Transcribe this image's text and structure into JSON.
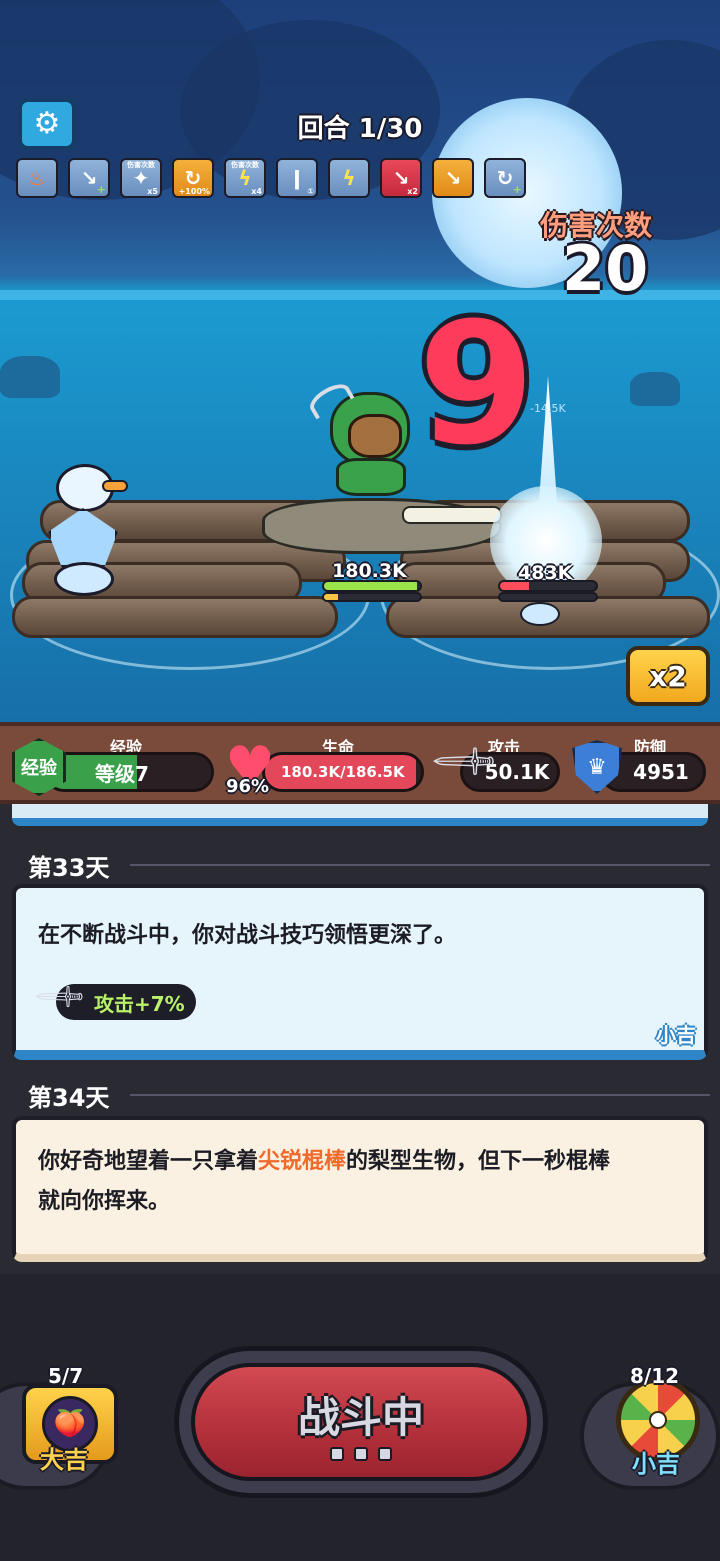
{
  "hud": {
    "round_label": "回合 1/30",
    "settings_icon": "gear-icon",
    "skill_icons": [
      {
        "icon": "flame-icon",
        "style": "orange-flame",
        "top_tag": "",
        "tag": ""
      },
      {
        "icon": "dagger-plus-icon",
        "style": "blue",
        "top_tag": "",
        "tag": ""
      },
      {
        "icon": "ice-shard-icon",
        "style": "blue",
        "top_tag": "伤害次数",
        "tag": "x5"
      },
      {
        "icon": "whirl-icon",
        "style": "orange",
        "top_tag": "",
        "tag": "+100%"
      },
      {
        "icon": "lightning-icon",
        "style": "blue",
        "top_tag": "伤害次数",
        "tag": "x4"
      },
      {
        "icon": "spear-icon",
        "style": "blue",
        "top_tag": "",
        "tag": "①"
      },
      {
        "icon": "thunder-strike-icon",
        "style": "blue",
        "top_tag": "",
        "tag": ""
      },
      {
        "icon": "dagger-icon",
        "style": "red",
        "top_tag": "",
        "tag": "x2"
      },
      {
        "icon": "dagger-clock-icon",
        "style": "orange",
        "top_tag": "",
        "tag": ""
      },
      {
        "icon": "whirl-plus-icon",
        "style": "blue",
        "top_tag": "",
        "tag": ""
      }
    ],
    "hits_title": "伤害次数",
    "hits_count": "20",
    "big_damage": "9",
    "small_damage": "-14.5K",
    "player_hp_label": "180.3K",
    "player_hp_fraction": 0.97,
    "player_energy_fraction": 0.15,
    "enemy_hp_label": "483K",
    "enemy_hp_fraction": 0.3,
    "speed_label": "x2"
  },
  "stats": {
    "exp": {
      "caption": "经验",
      "badge": "经验",
      "level": "等级7",
      "fraction": 0.55
    },
    "hp": {
      "caption": "生命",
      "percent": "96%",
      "value": "180.3K/186.5K",
      "fraction": 0.97
    },
    "atk": {
      "caption": "攻击",
      "value": "50.1K"
    },
    "def": {
      "caption": "防御",
      "value": "4951"
    }
  },
  "log": {
    "day33": {
      "title": "第33天",
      "text": "在不断战斗中，你对战斗技巧领悟更深了。",
      "buff": "攻击+7%",
      "sign": "小吉"
    },
    "day34": {
      "title": "第34天",
      "text_before": "你好奇地望着一只拿着",
      "text_highlight": "尖锐棍棒",
      "text_after": "的梨型生物，但下一秒棍棒",
      "text_line2": "就向你挥来。"
    }
  },
  "bottom": {
    "left_count": "5/7",
    "left_label": "大吉",
    "battle_label": "战斗中",
    "right_count": "8/12",
    "right_label": "小吉"
  },
  "colors": {
    "accent_red": "#ff3b5c",
    "hp_green": "#9be34a",
    "enemy_red": "#ff4d5e",
    "highlight_orange": "#f06a2c"
  }
}
